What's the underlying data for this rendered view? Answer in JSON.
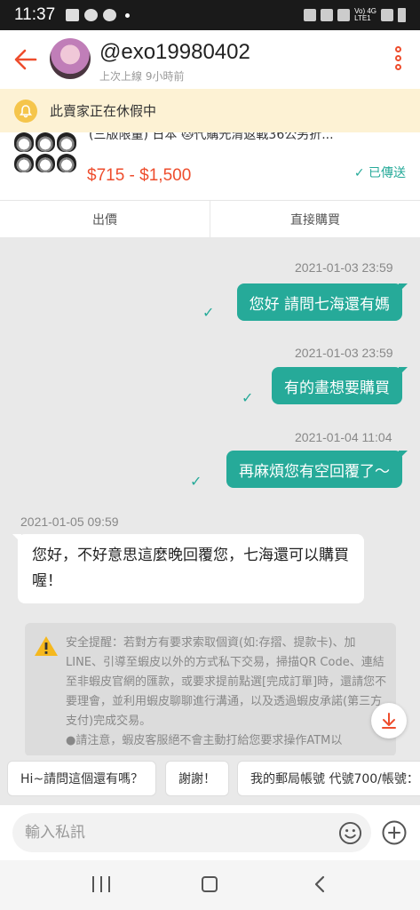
{
  "status_bar": {
    "time": "11:37",
    "network": "Vo) 4G\nLTE1"
  },
  "header": {
    "username": "@exo19980402",
    "last_seen": "上次上線 9小時前"
  },
  "vacation_banner": {
    "text": "此賣家正在休假中"
  },
  "product": {
    "title": "(三版限量) 日本 🐱代購光清返戰36公另折...",
    "price": "$715 - $1,500",
    "status": "✓ 已傳送"
  },
  "actions": {
    "offer": "出價",
    "buy_now": "直接購買"
  },
  "messages": [
    {
      "timestamp": "2021-01-03 23:59",
      "text": "您好 請問七海還有媽",
      "direction": "out"
    },
    {
      "timestamp": "2021-01-03 23:59",
      "text": "有的畫想要購買",
      "direction": "out"
    },
    {
      "timestamp": "2021-01-04 11:04",
      "text": "再麻煩您有空回覆了～",
      "direction": "out"
    },
    {
      "timestamp": "2021-01-05 09:59",
      "text": "您好，不好意思這麼晚回覆您，七海還可以購買喔！",
      "direction": "in"
    }
  ],
  "safety": {
    "text": "安全提醒：若對方有要求索取個資(如:存摺、提款卡)、加LINE、引導至蝦皮以外的方式私下交易，掃描QR Code、連結至非蝦皮官網的匯款，或要求提前點選[完成訂單]時，還請您不要理會，並利用蝦皮聊聊進行溝通，以及透過蝦皮承諾(第三方支付)完成交易。",
    "note": "●請注意，蝦皮客服絕不會主動打給您要求操作ATM以"
  },
  "quick_replies": [
    "Hi~請問這個還有嗎？",
    "謝謝！",
    "我的郵局帳號 代號700/帳號："
  ],
  "input": {
    "placeholder": "輸入私訊"
  },
  "colors": {
    "brand": "#ee4d2d",
    "chat_green": "#26aa99",
    "banner": "#fdf2d4"
  }
}
